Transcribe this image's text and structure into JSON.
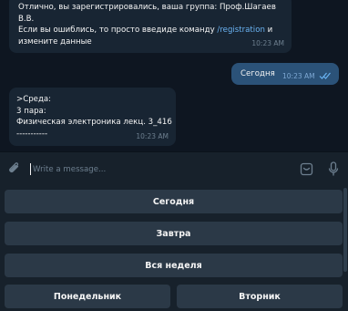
{
  "messages": {
    "first": {
      "lines": [
        "Отлично, вы зарегистрировались, ваша группа: Проф.Шагаев",
        "В.В."
      ],
      "line3_prefix": "Если вы ошиблись, то просто введиде команду ",
      "line3_link": "/registration",
      "line3_suffix": " и",
      "line4": "измените данные",
      "time": "10:23 AM"
    },
    "sent": {
      "text": "Сегодня",
      "time": "10:23 AM"
    },
    "schedule": {
      "lines": [
        ">Среда:",
        "3 пара:",
        "Физическая электроника лекц. 3_416",
        "-----------"
      ],
      "time": "10:23 AM"
    }
  },
  "composer": {
    "placeholder": "Write a message...",
    "icons": [
      "paperclip-icon",
      "sticker-icon",
      "microphone-icon"
    ]
  },
  "keyboard": {
    "buttons": [
      "Сегодня",
      "Завтра",
      "Вся неделя",
      "Понедельник",
      "Вторник"
    ]
  },
  "colors": {
    "chat_bg": "#0e1621",
    "incoming_bubble": "#182533",
    "outgoing_bubble": "#2b5278",
    "link": "#6ab3f3",
    "keyboard_button": "#2b3947"
  }
}
